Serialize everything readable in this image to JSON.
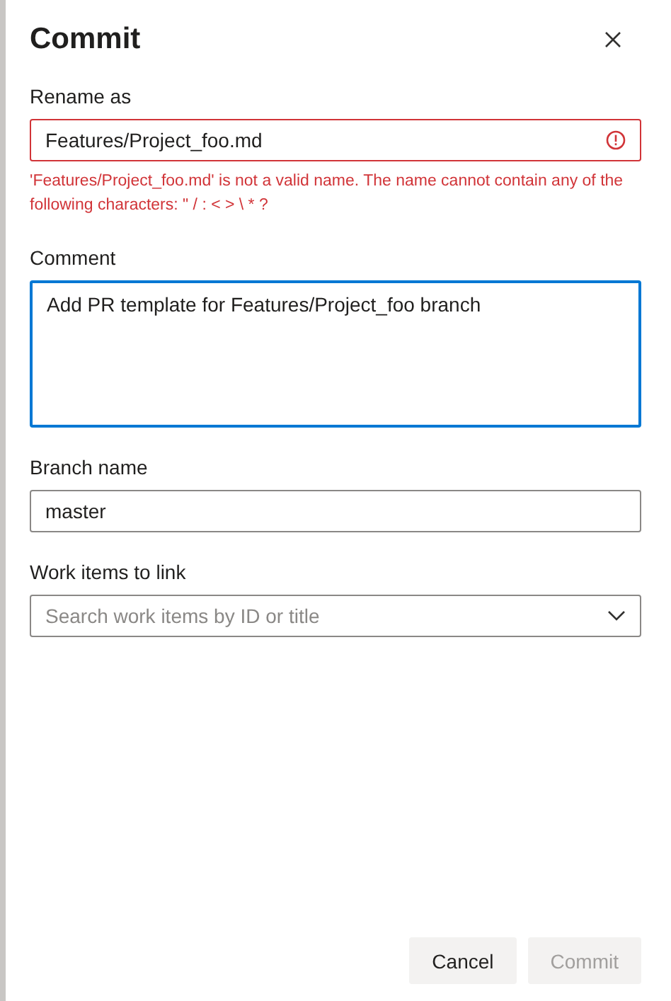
{
  "dialog": {
    "title": "Commit"
  },
  "fields": [
    {
      "kind": "input",
      "label": "Rename as",
      "value": "Features/Project_foo.md",
      "error": "'Features/Project_foo.md' is not a valid name. The name cannot contain any of the following characters: \" / : < > \\ * ?",
      "focused": false
    },
    {
      "kind": "textarea",
      "label": "Comment",
      "value": "Add PR template for Features/Project_foo branch",
      "focused": true
    },
    {
      "kind": "input",
      "label": "Branch name",
      "value": "master",
      "focused": false
    },
    {
      "kind": "dropdown",
      "label": "Work items to link",
      "placeholder": "Search work items by ID or title",
      "focused": false
    }
  ],
  "buttons": [
    {
      "label": "Cancel",
      "disabled": false
    },
    {
      "label": "Commit",
      "disabled": true
    }
  ]
}
